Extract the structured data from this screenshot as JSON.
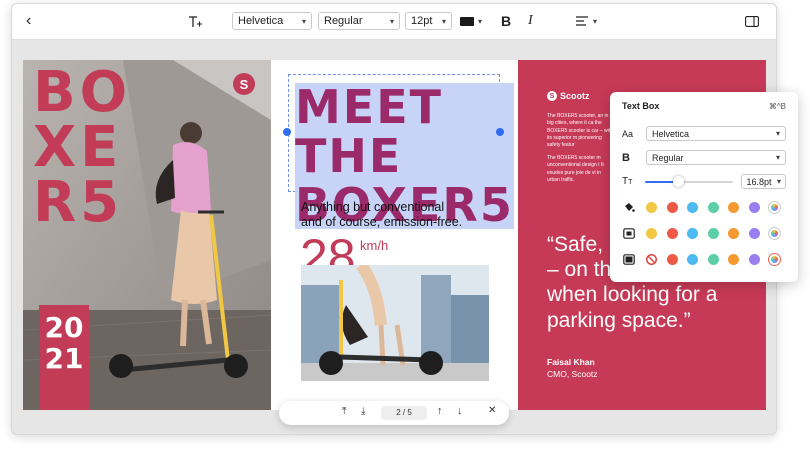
{
  "toolbar": {
    "font_family": "Helvetica",
    "font_style": "Regular",
    "font_size": "12pt",
    "text_color": "#1a1a1a"
  },
  "page1": {
    "title_lines": [
      "BO",
      "XE",
      "R5"
    ],
    "year_lines": [
      "20",
      "21"
    ],
    "logo": "S"
  },
  "page2": {
    "headline_lines": [
      "MEET THE",
      "BOXER5"
    ],
    "subtitle_lines": [
      "Anything but conventional",
      "and of course, emission-free."
    ],
    "speed_value": "28",
    "speed_unit": "km/h"
  },
  "page3": {
    "brand": "Scootz",
    "body1": "The BOXER5 scooter, an in big cities, where it ca the BOXER5 scooter is car – with its superior m pioneering safety featur",
    "body2": "The BOXER5 scooter m unconventional design t It exudes pure joie de vi in urban traffic.",
    "quote_lines": [
      "“Safe,",
      "– on th",
      "when looking for a",
      "parking space.”"
    ],
    "author": "Faisal Khan",
    "author_title": "CMO, Scootz"
  },
  "panel": {
    "title": "Text Box",
    "shortcut": "⌘^B",
    "font_label": "Aa",
    "font_value": "Helvetica",
    "weight_label": "B",
    "weight_value": "Regular",
    "size_label": "TT",
    "size_value": "16.8pt",
    "size_slider_fraction": 0.37,
    "fill_colors": [
      "#f2c744",
      "#ee5a46",
      "#4cb9f0",
      "#5dcfa7",
      "#f59a30",
      "#9b7ff0"
    ],
    "stroke_colors": [
      "#f2c744",
      "#ee5a46",
      "#4cb9f0",
      "#5dcfa7",
      "#f59a30",
      "#9b7ff0"
    ],
    "shadow_colors": [
      "#ee5a46",
      "#4cb9f0",
      "#5dcfa7",
      "#f59a30",
      "#9b7ff0"
    ]
  },
  "pager": {
    "page_indicator": "2 / 5"
  }
}
